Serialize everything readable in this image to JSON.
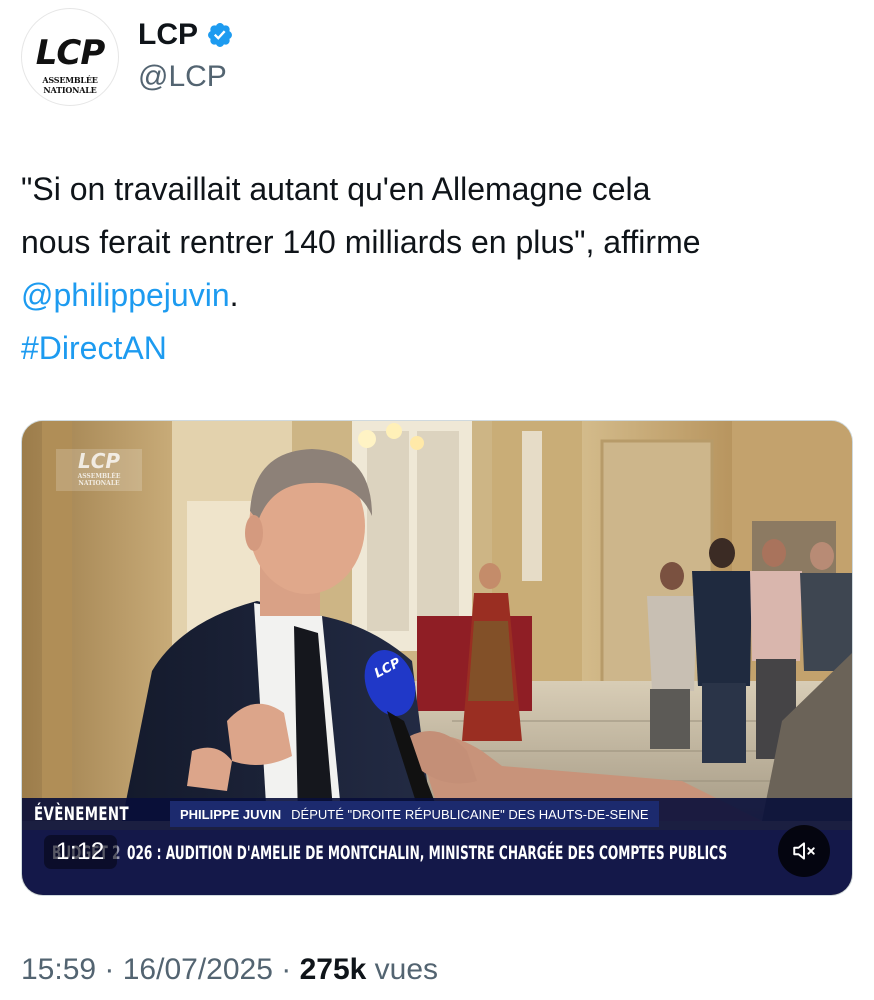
{
  "author": {
    "avatar_logo": "LCP",
    "avatar_subtitle": "ASSEMBLÉE NATIONALE",
    "display_name": "LCP",
    "handle": "@LCP",
    "verified_icon": "verified-badge-icon",
    "verified_color": "#1d9bf0"
  },
  "tweet": {
    "text_line1": "\"Si on travaillait autant qu'en Allemagne cela",
    "text_line2": "nous ferait rentrer 140 milliards en plus\", affirme",
    "mention": "@philippejuvin",
    "mention_suffix": ".",
    "hashtag": "#DirectAN",
    "link_color": "#1d9bf0"
  },
  "video": {
    "watermark_logo": "LCP",
    "watermark_subtitle": "ASSEMBLÉE NATIONALE",
    "mic_logo": "LCP",
    "event_label": "ÉVÈNEMENT",
    "person_name": "PHILIPPE JUVIN",
    "person_role": "DÉPUTÉ \"DROITE RÉPUBLICAINE\" DES HAUTS-DE-SEINE",
    "ticker_hidden": "BUDGET 2",
    "ticker_text": "026 : AUDITION D'AMELIE DE MONTCHALIN, MINISTRE CHARGÉE DES COMPTES PUBLICS",
    "time_remaining": "1:12",
    "mute_icon": "speaker-muted-icon"
  },
  "footer": {
    "time": "15:59",
    "separator": " · ",
    "date": "16/07/2025",
    "views_count": "275k",
    "views_label": " vues"
  }
}
